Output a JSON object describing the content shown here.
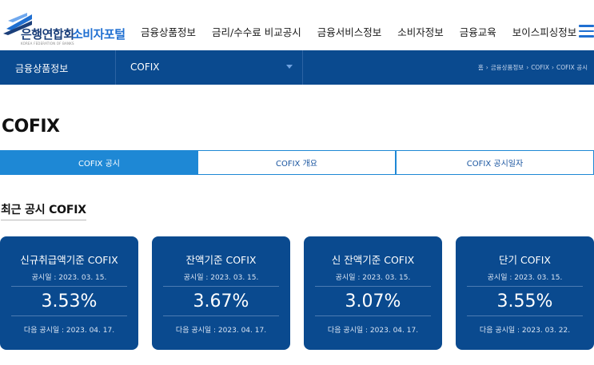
{
  "header": {
    "logo_main": "은행연합회",
    "logo_sub": "소비자포털",
    "logo_tag": "KOREA FEDERATION OF BANKS",
    "nav": [
      "금융상품정보",
      "금리/수수료 비교공시",
      "금융서비스정보",
      "소비자정보",
      "금융교육",
      "보이스피싱정보"
    ],
    "menu_icon": "hamburger-menu-icon"
  },
  "subbar": {
    "category": "금융상품정보",
    "selected": "COFIX",
    "breadcrumb": [
      "홈",
      "금융상품정보",
      "COFIX",
      "COFIX 공시"
    ]
  },
  "page": {
    "title": "COFIX",
    "tabs": [
      "COFIX 공시",
      "COFIX 개요",
      "COFIX 공시일자"
    ],
    "active_tab": "COFIX 공시",
    "section_title": "최근 공시 COFIX"
  },
  "cards": [
    {
      "name": "신규취급액기준 COFIX",
      "date": "공시일 : 2023. 03. 15.",
      "rate": "3.53%",
      "next": "다음 공시일 : 2023. 04. 17."
    },
    {
      "name": "잔액기준 COFIX",
      "date": "공시일 : 2023. 03. 15.",
      "rate": "3.67%",
      "next": "다음 공시일 : 2023. 04. 17."
    },
    {
      "name": "신 잔액기준 COFIX",
      "date": "공시일 : 2023. 03. 15.",
      "rate": "3.07%",
      "next": "다음 공시일 : 2023. 04. 17."
    },
    {
      "name": "단기 COFIX",
      "date": "공시일 : 2023. 03. 15.",
      "rate": "3.55%",
      "next": "다음 공시일 : 2023. 03. 22."
    }
  ],
  "colors": {
    "brand_navy": "#0a4a8f",
    "tab_blue": "#1e88d5",
    "logo_blue": "#1f6fd1"
  }
}
